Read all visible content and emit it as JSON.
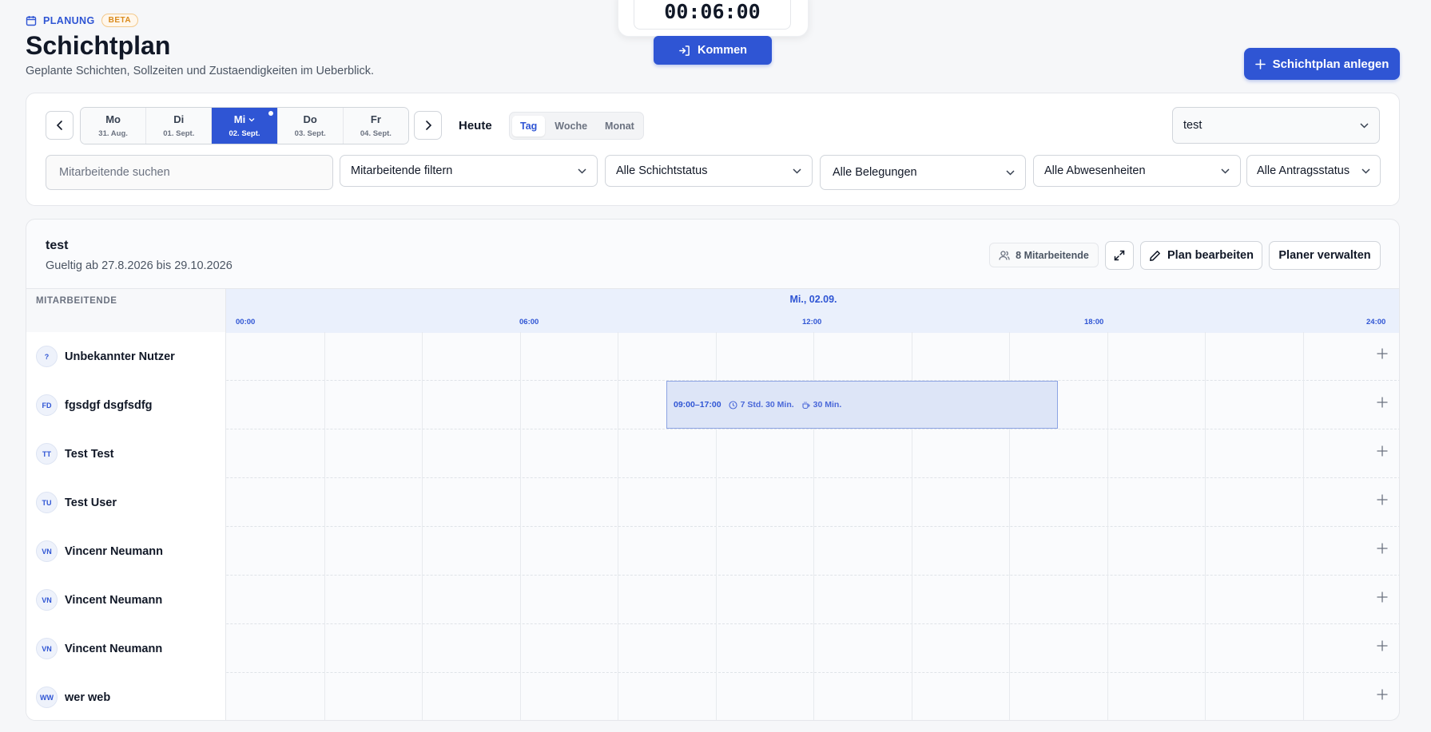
{
  "header": {
    "section_label": "PLANUNG",
    "beta_badge": "BETA",
    "title": "Schichtplan",
    "subtitle": "Geplante Schichten, Sollzeiten und Zustaendigkeiten im Ueberblick.",
    "timer": "00:06:00",
    "kommen_label": "Kommen",
    "create_label": "Schichtplan anlegen"
  },
  "filters": {
    "days": [
      {
        "name": "Mo",
        "date": "31. Aug."
      },
      {
        "name": "Di",
        "date": "01. Sept."
      },
      {
        "name": "Mi",
        "date": "02. Sept."
      },
      {
        "name": "Do",
        "date": "03. Sept."
      },
      {
        "name": "Fr",
        "date": "04. Sept."
      }
    ],
    "heute_label": "Heute",
    "views": [
      "Tag",
      "Woche",
      "Monat"
    ],
    "plan_select": "test",
    "search_placeholder": "Mitarbeitende suchen",
    "employee_filter": "Mitarbeitende filtern",
    "shift_status": "Alle Schichtstatus",
    "assignments": "Alle Belegungen",
    "absences": "Alle Abwesenheiten",
    "request_status": "Alle Antragsstatus"
  },
  "plan": {
    "title": "test",
    "validity": "Gueltig ab 27.8.2026 bis 29.10.2026",
    "employee_count": "8 Mitarbeitende",
    "edit_label": "Plan bearbeiten",
    "manage_label": "Planer verwalten",
    "column_header": "MITARBEITENDE",
    "day_label": "Mi., 02.09.",
    "ticks": [
      "00:00",
      "06:00",
      "12:00",
      "18:00",
      "24:00"
    ],
    "employees": [
      {
        "initials": "?",
        "name": "Unbekannter Nutzer"
      },
      {
        "initials": "FD",
        "name": "fgsdgf dsgfsdfg"
      },
      {
        "initials": "TT",
        "name": "Test Test"
      },
      {
        "initials": "TU",
        "name": "Test User"
      },
      {
        "initials": "VN",
        "name": "Vincenr Neumann"
      },
      {
        "initials": "VN",
        "name": "Vincent Neumann"
      },
      {
        "initials": "VN",
        "name": "Vincent Neumann"
      },
      {
        "initials": "WW",
        "name": "wer web"
      }
    ],
    "shift": {
      "time": "09:00–17:00",
      "duration": "7 Std. 30 Min.",
      "break": "30 Min."
    }
  },
  "colors": {
    "accent": "#2f55d4",
    "beta": "#d98a1c"
  }
}
